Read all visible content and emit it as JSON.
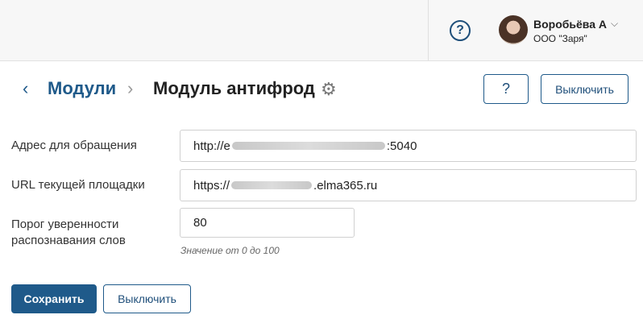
{
  "header": {
    "help_icon": "help-circle-icon",
    "help_glyph": "?",
    "user_name": "Воробьёва А",
    "user_org": "ООО \"Заря\"",
    "chevron_glyph": "⌵"
  },
  "breadcrumb": {
    "back_glyph": "‹",
    "parent": "Модули",
    "separator": "›",
    "title": "Модуль антифрод",
    "settings_icon": "gear-icon",
    "gear_glyph": "⚙"
  },
  "actions": {
    "help_glyph": "?",
    "disable_label": "Выключить"
  },
  "form": {
    "address": {
      "label": "Адрес для обращения",
      "value_prefix": "http://e",
      "value_suffix": ":5040"
    },
    "url": {
      "label": "URL текущей площадки",
      "value_prefix": "https://",
      "value_suffix": ".elma365.ru"
    },
    "threshold": {
      "label": "Порог уверенности распознавания слов",
      "value": "80",
      "hint": "Значение от 0 до 100"
    }
  },
  "footer": {
    "save_label": "Сохранить",
    "disable_label": "Выключить"
  },
  "colors": {
    "primary": "#1f5a8a",
    "topbar": "#f7f7f7"
  }
}
